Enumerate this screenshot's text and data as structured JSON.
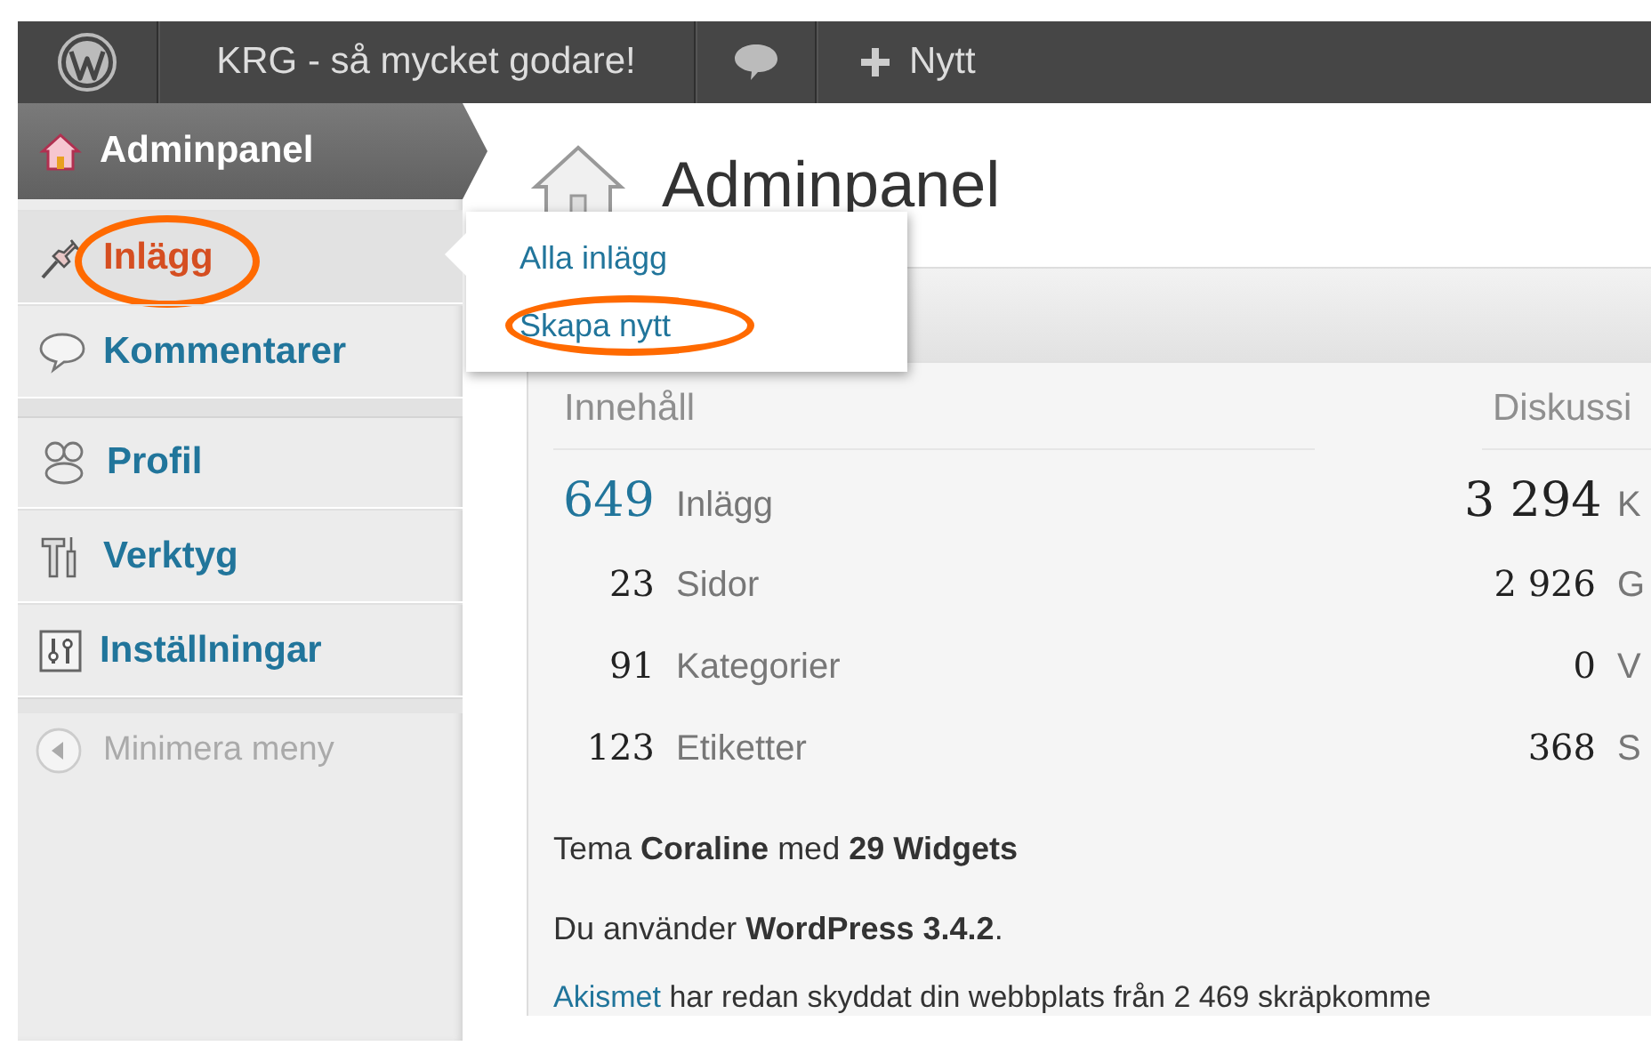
{
  "topbar": {
    "site_title": "KRG - så mycket godare!",
    "new_label": "Nytt"
  },
  "sidebar": {
    "items": [
      {
        "label": "Adminpanel",
        "selected": true,
        "hovered": false,
        "circled": false,
        "separator_before": false
      },
      {
        "label": "Inlägg",
        "selected": false,
        "hovered": true,
        "circled": true,
        "separator_before": false
      },
      {
        "label": "Kommentarer",
        "selected": false,
        "hovered": false,
        "circled": false,
        "separator_before": false
      },
      {
        "label": "Profil",
        "selected": false,
        "hovered": false,
        "circled": false,
        "separator_before": true
      },
      {
        "label": "Verktyg",
        "selected": false,
        "hovered": false,
        "circled": false,
        "separator_before": false
      },
      {
        "label": "Inställningar",
        "selected": false,
        "hovered": false,
        "circled": false,
        "separator_before": false
      }
    ],
    "collapse_label": "Minimera meny"
  },
  "flyout": {
    "items": [
      {
        "label": "Alla inlägg",
        "circled": false
      },
      {
        "label": "Skapa nytt",
        "circled": true
      }
    ]
  },
  "page": {
    "title": "Adminpanel"
  },
  "right_now": {
    "content": {
      "heading": "Innehåll",
      "rows": [
        {
          "count": "649",
          "label": "Inlägg",
          "emphasis": true
        },
        {
          "count": "23",
          "label": "Sidor",
          "emphasis": false
        },
        {
          "count": "91",
          "label": "Kategorier",
          "emphasis": false
        },
        {
          "count": "123",
          "label": "Etiketter",
          "emphasis": false
        }
      ]
    },
    "discussion": {
      "heading": "Diskussi",
      "rows": [
        {
          "count": "3 294",
          "label": "K",
          "emphasis": true
        },
        {
          "count": "2 926",
          "label": "G",
          "emphasis": false
        },
        {
          "count": "0",
          "label": "V",
          "emphasis": false
        },
        {
          "count": "368",
          "label": "S",
          "emphasis": false
        }
      ]
    },
    "theme_line": "Tema **Coraline** med **29 Widgets**",
    "version_line": "Du använder **WordPress 3.4.2**.",
    "akismet": {
      "link": "Akismet",
      "text": "har redan skyddat din webbplats från 2 469 skräpkomme"
    }
  }
}
